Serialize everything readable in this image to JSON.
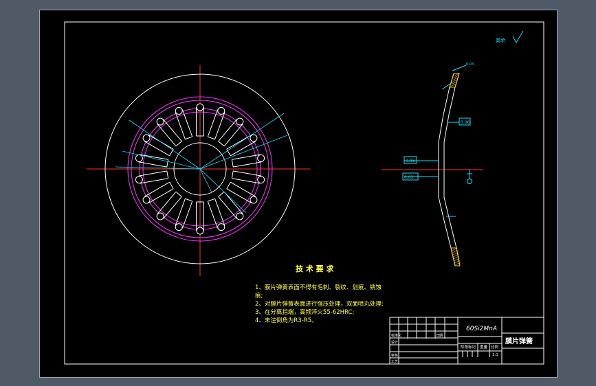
{
  "colors": {
    "background": "#4f5a66",
    "sheet": "#000000",
    "border": "#ffffff",
    "centerline": "#ff3030",
    "bolt_circle": "#ff30ff",
    "dimension": "#00e5ff",
    "text_yellow": "#ffff40",
    "hatch": "#ffd000"
  },
  "drawing": {
    "roughness_note": "其余",
    "tech_title": "技 术 要 求",
    "tech_requirements": [
      "1、膜片弹簧表面不得有毛刺、裂纹、划痕、锈蚀",
      "痕;",
      "2、对膜片弹簧表面进行强压处理，双面喷丸处理;",
      "3、在分离指端，高频淬火55-62HRC;",
      "4、未注倒角为R3-R5。"
    ],
    "side_view_boxes": [
      "0.06",
      "0.03",
      "0.03",
      "0.03"
    ]
  },
  "title_block": {
    "material": "60Si2MnA",
    "part_name": "膜片弹簧",
    "scale": "1:1",
    "col_stage": "阶段标记",
    "col_weight": "重量",
    "col_scale": "比例",
    "row_standard": "标准化",
    "row_date": "日期",
    "row_design": "设计",
    "row_review": "审核",
    "row_process": "工艺"
  }
}
